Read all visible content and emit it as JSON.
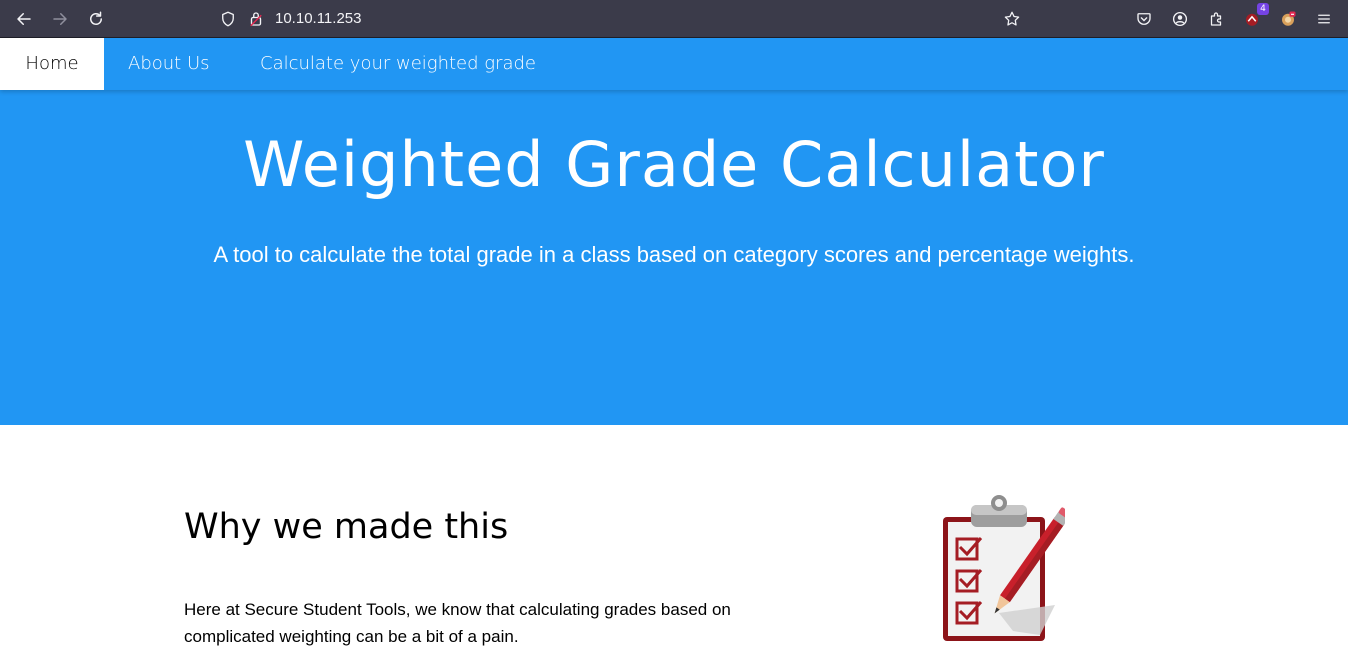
{
  "browser": {
    "url": "10.10.11.253",
    "extension_badge": "4"
  },
  "nav": {
    "items": [
      {
        "label": "Home"
      },
      {
        "label": "About Us"
      },
      {
        "label": "Calculate your weighted grade"
      }
    ]
  },
  "hero": {
    "title": "Weighted Grade Calculator",
    "subtitle": "A tool to calculate the total grade in a class based on category scores and percentage weights."
  },
  "section": {
    "title": "Why we made this",
    "text": "Here at Secure Student Tools, we know that calculating grades based on complicated weighting can be a bit of a pain."
  },
  "colors": {
    "brand": "#2196f3",
    "browser_bg": "#3b3b4a",
    "clipboard_accent": "#a51d24"
  },
  "icons": [
    "back-icon",
    "forward-icon",
    "reload-icon",
    "shield-icon",
    "lock-icon",
    "star-icon",
    "pocket-icon",
    "account-icon",
    "extensions-icon",
    "extension-icon",
    "addon-icon",
    "menu-icon",
    "clipboard-checklist-icon"
  ]
}
